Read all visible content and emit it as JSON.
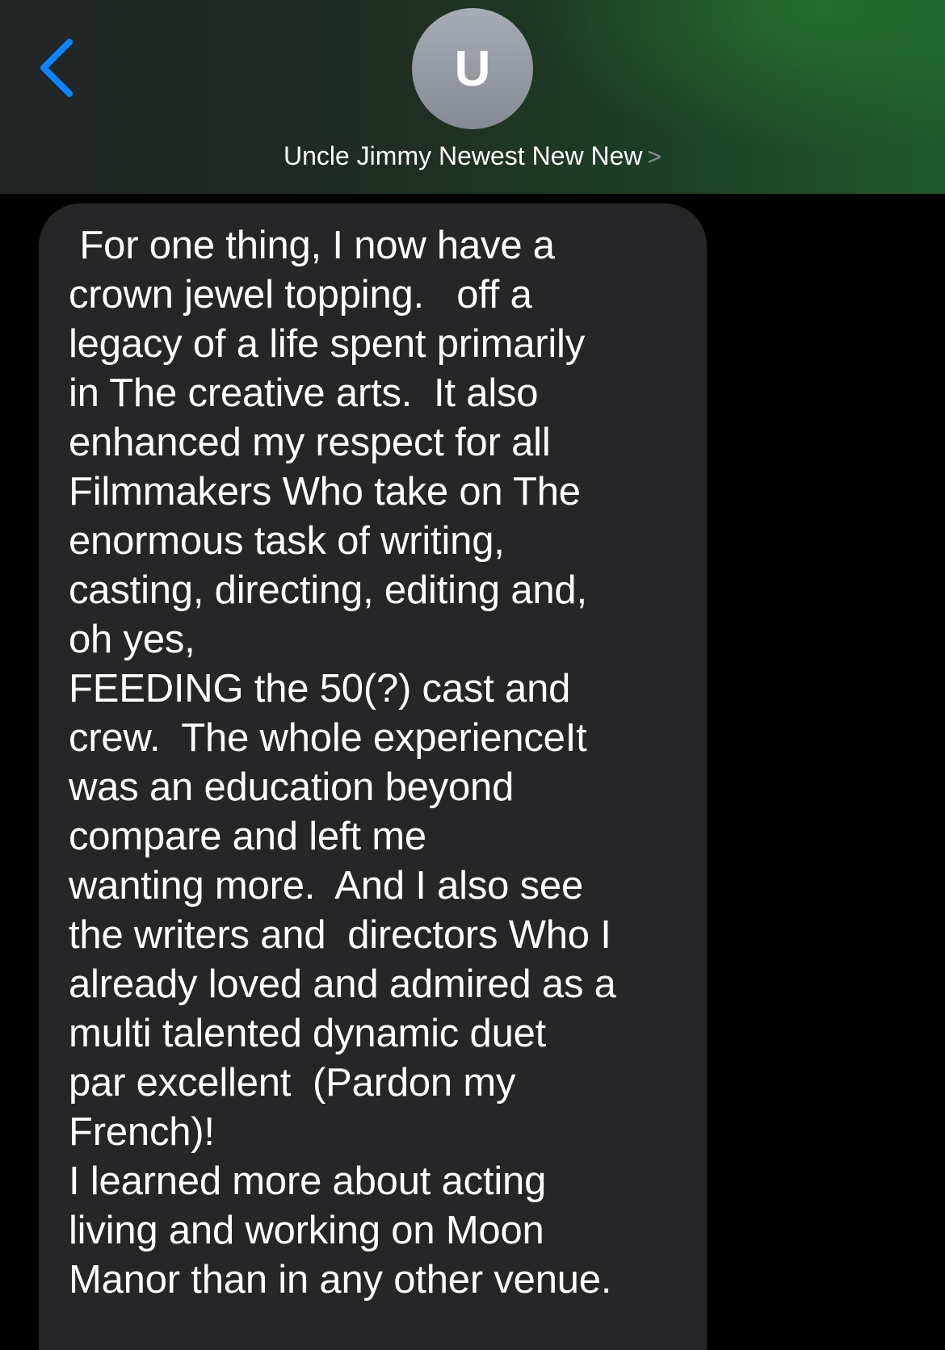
{
  "header": {
    "back_icon": "chevron-left-icon",
    "avatar_initial": "U",
    "contact_name": "Uncle Jimmy Newest New New",
    "contact_chevron": ">",
    "accent_color": "#0a84ff"
  },
  "message": {
    "text": " For one thing, I now have a\ncrown jewel topping.   off a\nlegacy of a life spent primarily\nin The creative arts.  It also\nenhanced my respect for all\nFilmmakers Who take on The\nenormous task of writing,\ncasting, directing, editing and,\noh yes,\nFEEDING the 50(?) cast and\ncrew.  The whole experienceIt\nwas an education beyond\ncompare and left me\nwanting more.  And I also see\nthe writers and  directors Who I\nalready loved and admired as a\nmulti talented dynamic duet\npar excellent  (Pardon my\nFrench)!\nI learned more about acting\nliving and working on Moon\nManor than in any other venue."
  }
}
